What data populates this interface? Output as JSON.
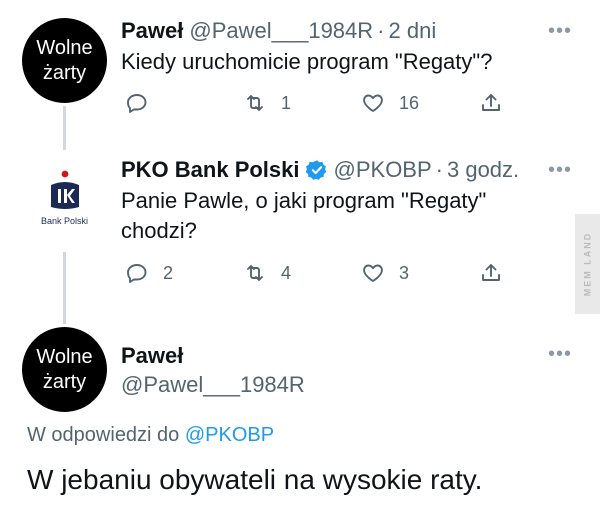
{
  "tweet1": {
    "avatar_line1": "Wolne",
    "avatar_line2": "żarty",
    "name": "Paweł",
    "handle": "@Pawel___1984R",
    "separator": "·",
    "time": "2 dni",
    "more": "•••",
    "text": "Kiedy uruchomicie program \"Regaty\"?",
    "reply_count": "",
    "retweet_count": "1",
    "like_count": "16"
  },
  "tweet2": {
    "avatar_caption": "Bank Polski",
    "name": "PKO Bank Polski",
    "handle": "@PKOBP",
    "separator": "·",
    "time": "3 godz.",
    "more": "•••",
    "text_line1": "Panie Pawle, o jaki program \"Regaty\"",
    "text_line2": "chodzi?",
    "reply_count": "2",
    "retweet_count": "4",
    "like_count": "3"
  },
  "tweet3": {
    "avatar_line1": "Wolne",
    "avatar_line2": "żarty",
    "name": "Paweł",
    "handle": "@Pawel___1984R",
    "more": "•••",
    "reply_prefix": "W odpowiedzi do",
    "reply_mention": "@PKOBP",
    "text": "W jebaniu obywateli na wysokie raty."
  },
  "watermark": "MEM LAND",
  "colors": {
    "text": "#0f1419",
    "secondary": "#536471",
    "link": "#1d9bf0",
    "verified": "#1d9bf0",
    "thread_line": "#cfd9de"
  }
}
